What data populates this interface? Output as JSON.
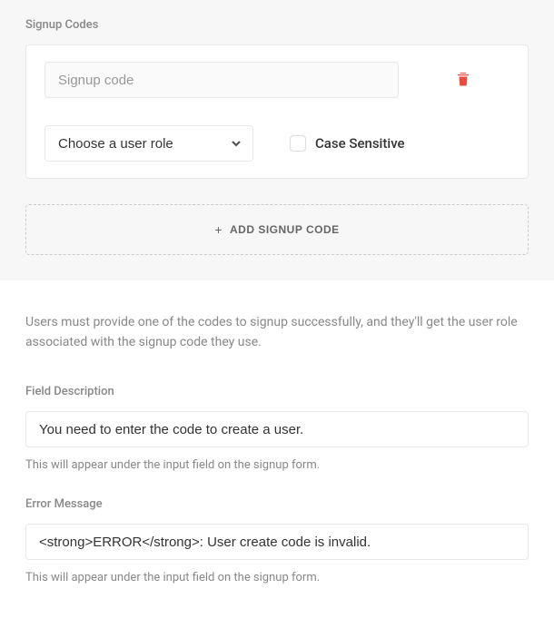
{
  "codes_section": {
    "title": "Signup Codes",
    "code_placeholder": "Signup code",
    "role_placeholder": "Choose a user role",
    "case_sensitive_label": "Case Sensitive",
    "add_button_label": "ADD SIGNUP CODE"
  },
  "info_text": "Users must provide one of the codes to signup successfully, and they'll get the user role associated with the signup code they use.",
  "field_description": {
    "label": "Field Description",
    "value": "You need to enter the code to create a user.",
    "helper": "This will appear under the input field on the signup form."
  },
  "error_message": {
    "label": "Error Message",
    "value": "<strong>ERROR</strong>: User create code is invalid.",
    "helper": "This will appear under the input field on the signup form."
  }
}
